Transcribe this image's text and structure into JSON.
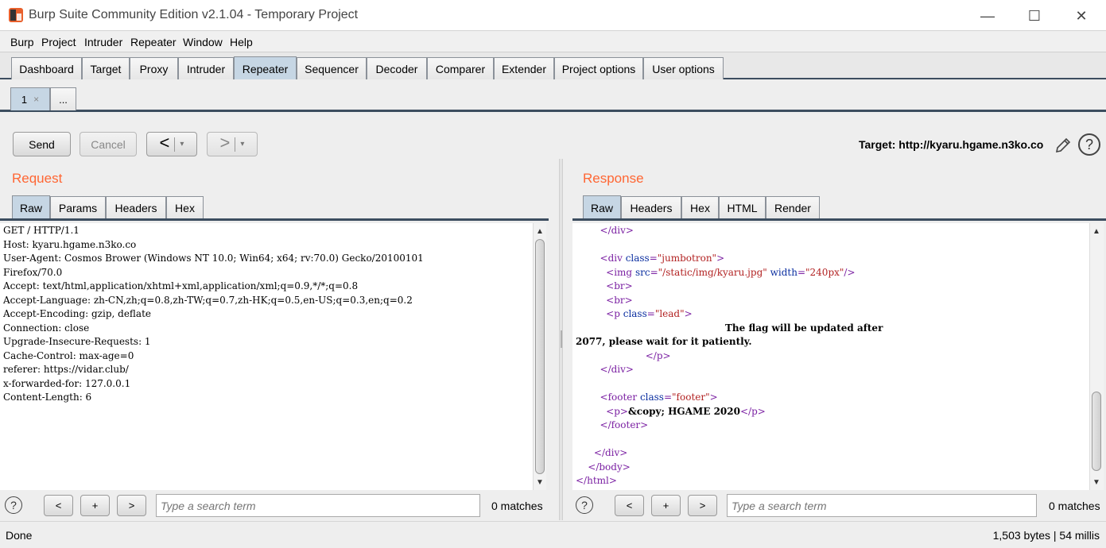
{
  "window": {
    "title": "Burp Suite Community Edition v2.1.04 - Temporary Project",
    "minimize_glyph": "—",
    "maximize_glyph": "☐",
    "close_glyph": "✕"
  },
  "menu": [
    "Burp",
    "Project",
    "Intruder",
    "Repeater",
    "Window",
    "Help"
  ],
  "main_tabs": [
    "Dashboard",
    "Target",
    "Proxy",
    "Intruder",
    "Repeater",
    "Sequencer",
    "Decoder",
    "Comparer",
    "Extender",
    "Project options",
    "User options"
  ],
  "active_main_tab": "Repeater",
  "sub_tabs": {
    "active_label": "1",
    "close_glyph": "×",
    "more_label": "..."
  },
  "toolbar": {
    "send_label": "Send",
    "cancel_label": "Cancel",
    "back_glyph": "<",
    "forward_glyph": ">",
    "dropdown_glyph": "▾",
    "target_text": "Target: http://kyaru.hgame.n3ko.co",
    "help_glyph": "?"
  },
  "request": {
    "title": "Request",
    "tabs": [
      "Raw",
      "Params",
      "Headers",
      "Hex"
    ],
    "active_tab": "Raw",
    "raw_lines": [
      "GET / HTTP/1.1",
      "Host: kyaru.hgame.n3ko.co",
      "User-Agent: Cosmos Brower (Windows NT 10.0; Win64; x64; rv:70.0) Gecko/20100101",
      "Firefox/70.0",
      "Accept: text/html,application/xhtml+xml,application/xml;q=0.9,*/*;q=0.8",
      "Accept-Language: zh-CN,zh;q=0.8,zh-TW;q=0.7,zh-HK;q=0.5,en-US;q=0.3,en;q=0.2",
      "Accept-Encoding: gzip, deflate",
      "Connection: close",
      "Upgrade-Insecure-Requests: 1",
      "Cache-Control: max-age=0",
      "referer: https://vidar.club/",
      "x-forwarded-for: 127.0.0.1",
      "Content-Length: 6"
    ],
    "search_placeholder": "Type a search term",
    "matches": "0 matches"
  },
  "response": {
    "title": "Response",
    "tabs": [
      "Raw",
      "Headers",
      "Hex",
      "HTML",
      "Render"
    ],
    "active_tab": "Raw",
    "search_placeholder": "Type a search term",
    "matches": "0 matches"
  },
  "search_buttons": {
    "prev": "<",
    "add": "+",
    "next": ">",
    "help": "?"
  },
  "status": {
    "left": "Done",
    "right": "1,503 bytes | 54 millis"
  },
  "colors": {
    "accent": "#ff6633",
    "active_tab": "#c6d6e4",
    "tab_line": "#3c4d5f"
  }
}
